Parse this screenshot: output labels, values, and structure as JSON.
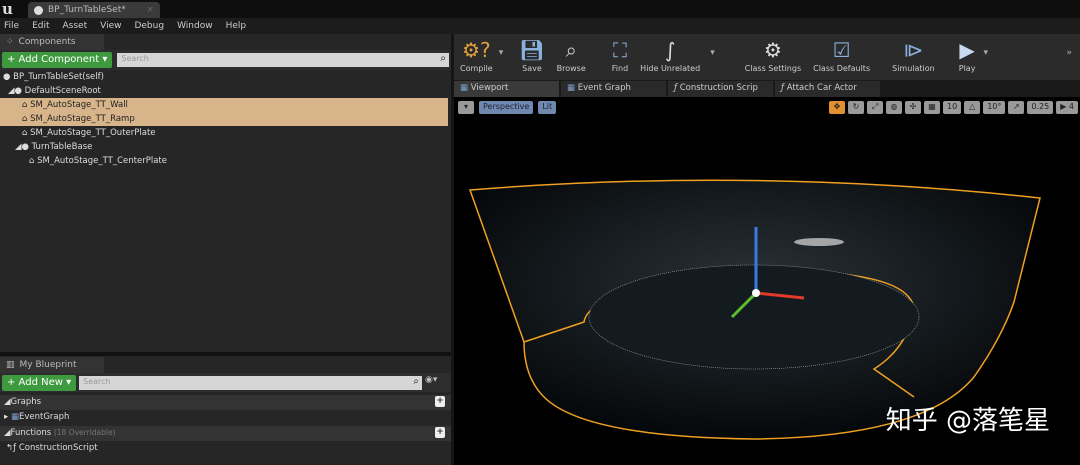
{
  "app": {
    "logo": "u",
    "doc_tab": "BP_TurnTableSet*",
    "tab_close": "×"
  },
  "menu": [
    "File",
    "Edit",
    "Asset",
    "View",
    "Debug",
    "Window",
    "Help"
  ],
  "components": {
    "tab": "Components",
    "add_label": "+ Add Component ▾",
    "search_placeholder": "Search",
    "tree": [
      {
        "label": "BP_TurnTableSet(self)",
        "level": 0,
        "selected": false
      },
      {
        "label": "DefaultSceneRoot",
        "level": 1,
        "selected": false
      },
      {
        "label": "SM_AutoStage_TT_Wall",
        "level": 2,
        "selected": true
      },
      {
        "label": "SM_AutoStage_TT_Ramp",
        "level": 2,
        "selected": true
      },
      {
        "label": "SM_AutoStage_TT_OuterPlate",
        "level": 2,
        "selected": false
      },
      {
        "label": "TurnTableBase",
        "level": 2,
        "selected": false
      },
      {
        "label": "SM_AutoStage_TT_CenterPlate",
        "level": 3,
        "selected": false
      }
    ]
  },
  "my_blueprint": {
    "tab": "My Blueprint",
    "add_label": "+ Add New ▾",
    "search_placeholder": "Search",
    "graphs": "Graphs",
    "event_graph": "EventGraph",
    "functions": "Functions",
    "functions_note": "(18 Overridable)",
    "construction_script": "ConstructionScript"
  },
  "toolbar": [
    {
      "label": "Compile",
      "icon": "compile-icon"
    },
    {
      "label": "Save",
      "icon": "save-icon"
    },
    {
      "label": "Browse",
      "icon": "browse-icon"
    },
    {
      "label": "Find",
      "icon": "find-icon"
    },
    {
      "label": "Hide Unrelated",
      "icon": "hide-unrelated-icon"
    },
    {
      "label": "Class Settings",
      "icon": "class-settings-icon"
    },
    {
      "label": "Class Defaults",
      "icon": "class-defaults-icon"
    },
    {
      "label": "Simulation",
      "icon": "simulation-icon"
    },
    {
      "label": "Play",
      "icon": "play-icon"
    }
  ],
  "editor_tabs": [
    "Viewport",
    "Event Graph",
    "Construction Scrip",
    "Attach Car Actor"
  ],
  "viewport": {
    "perspective": "Perspective",
    "lit": "Lit",
    "grid_snap": "10",
    "rot_snap": "10°",
    "scale_snap": "0.25",
    "cam_speed": "4"
  },
  "watermark": "知乎 @落笔星",
  "colors": {
    "selection": "#d8b48a",
    "accent_green": "#3e9a3e",
    "outline": "#f0a020"
  }
}
